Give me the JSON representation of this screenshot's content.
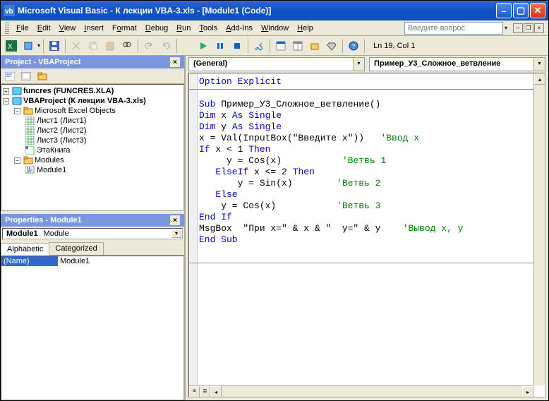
{
  "titlebar": {
    "text": "Microsoft Visual Basic - К лекции VBA-3.xls - [Module1 (Code)]"
  },
  "menubar": {
    "items": [
      "File",
      "Edit",
      "View",
      "Insert",
      "Format",
      "Debug",
      "Run",
      "Tools",
      "Add-Ins",
      "Window",
      "Help"
    ],
    "help_placeholder": "Введите вопрос"
  },
  "toolbar": {
    "status": "Ln 19, Col 1"
  },
  "project_panel": {
    "title": "Project - VBAProject",
    "nodes": {
      "funcres": "funcres (FUNCRES.XLA)",
      "vbaproject": "VBAProject (К лекции VBA-3.xls)",
      "excel_objects": "Microsoft Excel Objects",
      "sheet1": "Лист1 (Лист1)",
      "sheet2": "Лист2 (Лист2)",
      "sheet3": "Лист3 (Лист3)",
      "thisbook": "ЭтаКнига",
      "modules": "Modules",
      "module1": "Module1"
    }
  },
  "properties_panel": {
    "title": "Properties - Module1",
    "combo_name": "Module1",
    "combo_type": "Module",
    "tab_alpha": "Alphabetic",
    "tab_cat": "Categorized",
    "rows": [
      {
        "name": "(Name)",
        "value": "Module1"
      }
    ]
  },
  "code_dropdowns": {
    "left": "(General)",
    "right": "Пример_У3_Сложное_ветвление"
  },
  "code": {
    "l1": "Option Explicit",
    "l2": "",
    "l3_a": "Sub",
    "l3_b": " Пример_У3_Сложное_ветвление()",
    "l4_a": "Dim",
    "l4_b": " x ",
    "l4_c": "As Single",
    "l5_a": "Dim",
    "l5_b": " y ",
    "l5_c": "As Single",
    "l6_a": "x = Val(InputBox(\"Введите x\"))   ",
    "l6_c": "'Ввод x",
    "l7_a": "If",
    "l7_b": " x < 1 ",
    "l7_c": "Then",
    "l8_a": "     y = Cos(x)           ",
    "l8_c": "'Ветвь 1",
    "l9_a": "   ElseIf",
    "l9_b": " x <= 2 ",
    "l9_c": "Then",
    "l10_a": "       y = Sin(x)        ",
    "l10_c": "'Ветвь 2",
    "l11_a": "   Else",
    "l12_a": "    y = Cos(x)           ",
    "l12_c": "'Ветвь 3",
    "l13_a": "End If",
    "l14_a": "MsgBox  \"При x=\" & x & \"  y=\" & y    ",
    "l14_c": "'Вывод x, y",
    "l15_a": "End Sub"
  }
}
